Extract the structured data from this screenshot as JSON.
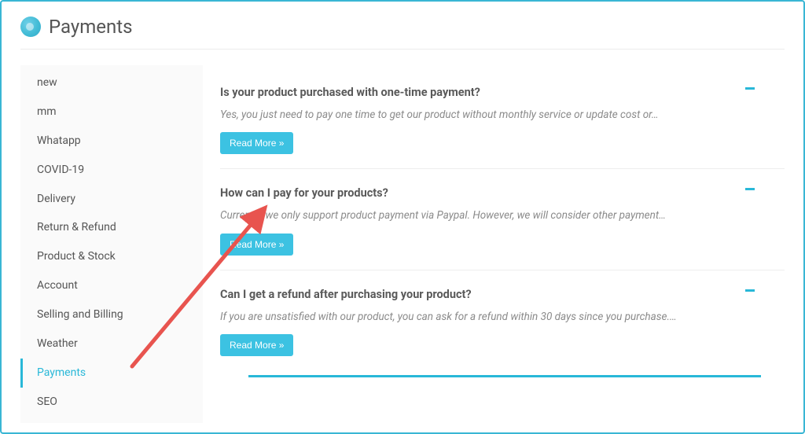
{
  "header": {
    "title": "Payments"
  },
  "sidebar": {
    "items": [
      {
        "label": "new",
        "active": false
      },
      {
        "label": "mm",
        "active": false
      },
      {
        "label": "Whatapp",
        "active": false
      },
      {
        "label": "COVID-19",
        "active": false
      },
      {
        "label": "Delivery",
        "active": false
      },
      {
        "label": "Return & Refund",
        "active": false
      },
      {
        "label": "Product & Stock",
        "active": false
      },
      {
        "label": "Account",
        "active": false
      },
      {
        "label": "Selling and Billing",
        "active": false
      },
      {
        "label": "Weather",
        "active": false
      },
      {
        "label": "Payments",
        "active": true
      },
      {
        "label": "SEO",
        "active": false
      }
    ]
  },
  "faq": {
    "items": [
      {
        "question": "Is your product purchased with one-time payment?",
        "answer": "Yes, you just need to pay one time to get our product without monthly service or update cost or…",
        "read_more": "Read More »"
      },
      {
        "question": "How can I pay for your products?",
        "answer": "Currently, we only support product payment via Paypal. However, we will consider other payment…",
        "read_more": "Read More »"
      },
      {
        "question": "Can I get a refund after purchasing your product?",
        "answer": "If you are unsatisfied with our product, you can ask for a refund within 30 days since you purchase.…",
        "read_more": "Read More »"
      }
    ]
  },
  "colors": {
    "accent": "#29b8d8"
  }
}
